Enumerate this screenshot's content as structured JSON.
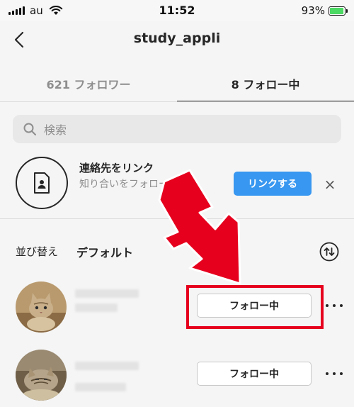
{
  "status_bar": {
    "carrier": "au",
    "time": "11:52",
    "battery": "93%",
    "battery_level": 0.93
  },
  "header": {
    "title": "study_appli",
    "back_icon": "chevron-left-icon"
  },
  "tabs": [
    {
      "label": "621 フォロワー",
      "active": false
    },
    {
      "label": "8 フォロー中",
      "active": true
    }
  ],
  "search": {
    "placeholder": "検索",
    "icon": "search-icon"
  },
  "contacts": {
    "title": "連絡先をリンク",
    "description": "知り合いをフォローしよう",
    "button_label": "リンクする",
    "dismiss": "×",
    "accent": "#3897f0"
  },
  "sort": {
    "label": "並び替え",
    "value": "デフォルト",
    "icon": "sort-arrows-icon"
  },
  "users": [
    {
      "button_label": "フォロー中",
      "avatar": "cat-photo-1"
    },
    {
      "button_label": "フォロー中",
      "avatar": "cat-photo-2"
    }
  ],
  "annotation": {
    "color": "#e6001e"
  }
}
